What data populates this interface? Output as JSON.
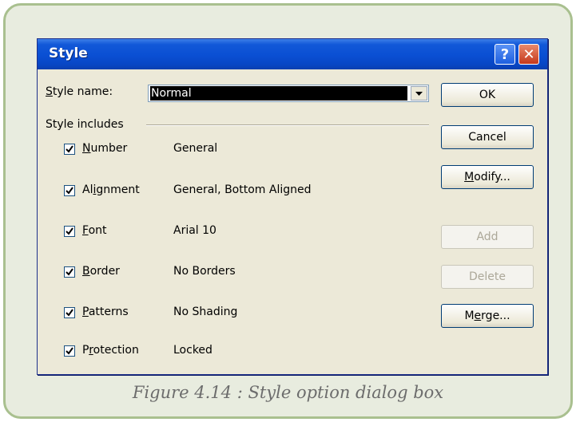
{
  "dialog": {
    "title": "Style",
    "help_glyph": "?",
    "close_glyph": "✕"
  },
  "style_name": {
    "label_prefix": "",
    "label_accel": "S",
    "label_rest": "tyle name:",
    "value": "Normal"
  },
  "style_includes": {
    "heading": "Style includes",
    "items": [
      {
        "accel": "N",
        "rest": "umber",
        "pre": "",
        "value": "General",
        "checked": true
      },
      {
        "pre": "Al",
        "accel": "i",
        "rest": "gnment",
        "value": "General, Bottom Aligned",
        "checked": true
      },
      {
        "pre": "",
        "accel": "F",
        "rest": "ont",
        "value": "Arial 10",
        "checked": true
      },
      {
        "pre": "",
        "accel": "B",
        "rest": "order",
        "value": "No Borders",
        "checked": true
      },
      {
        "pre": "",
        "accel": "P",
        "rest": "atterns",
        "value": "No Shading",
        "checked": true
      },
      {
        "pre": "P",
        "accel": "r",
        "rest": "otection",
        "value": "Locked",
        "checked": true
      }
    ]
  },
  "buttons": {
    "ok": "OK",
    "cancel": "Cancel",
    "modify_accel": "M",
    "modify_rest": "odify...",
    "add": "Add",
    "delete": "Delete",
    "merge_pre": "M",
    "merge_accel": "e",
    "merge_rest": "rge..."
  },
  "caption": "Figure 4.14 : Style option dialog box",
  "colors": {
    "titlebar": "#0a4fd3",
    "dialog_bg": "#ece9d8",
    "frame_border": "#a9c08f",
    "close_button": "#c5381c"
  }
}
